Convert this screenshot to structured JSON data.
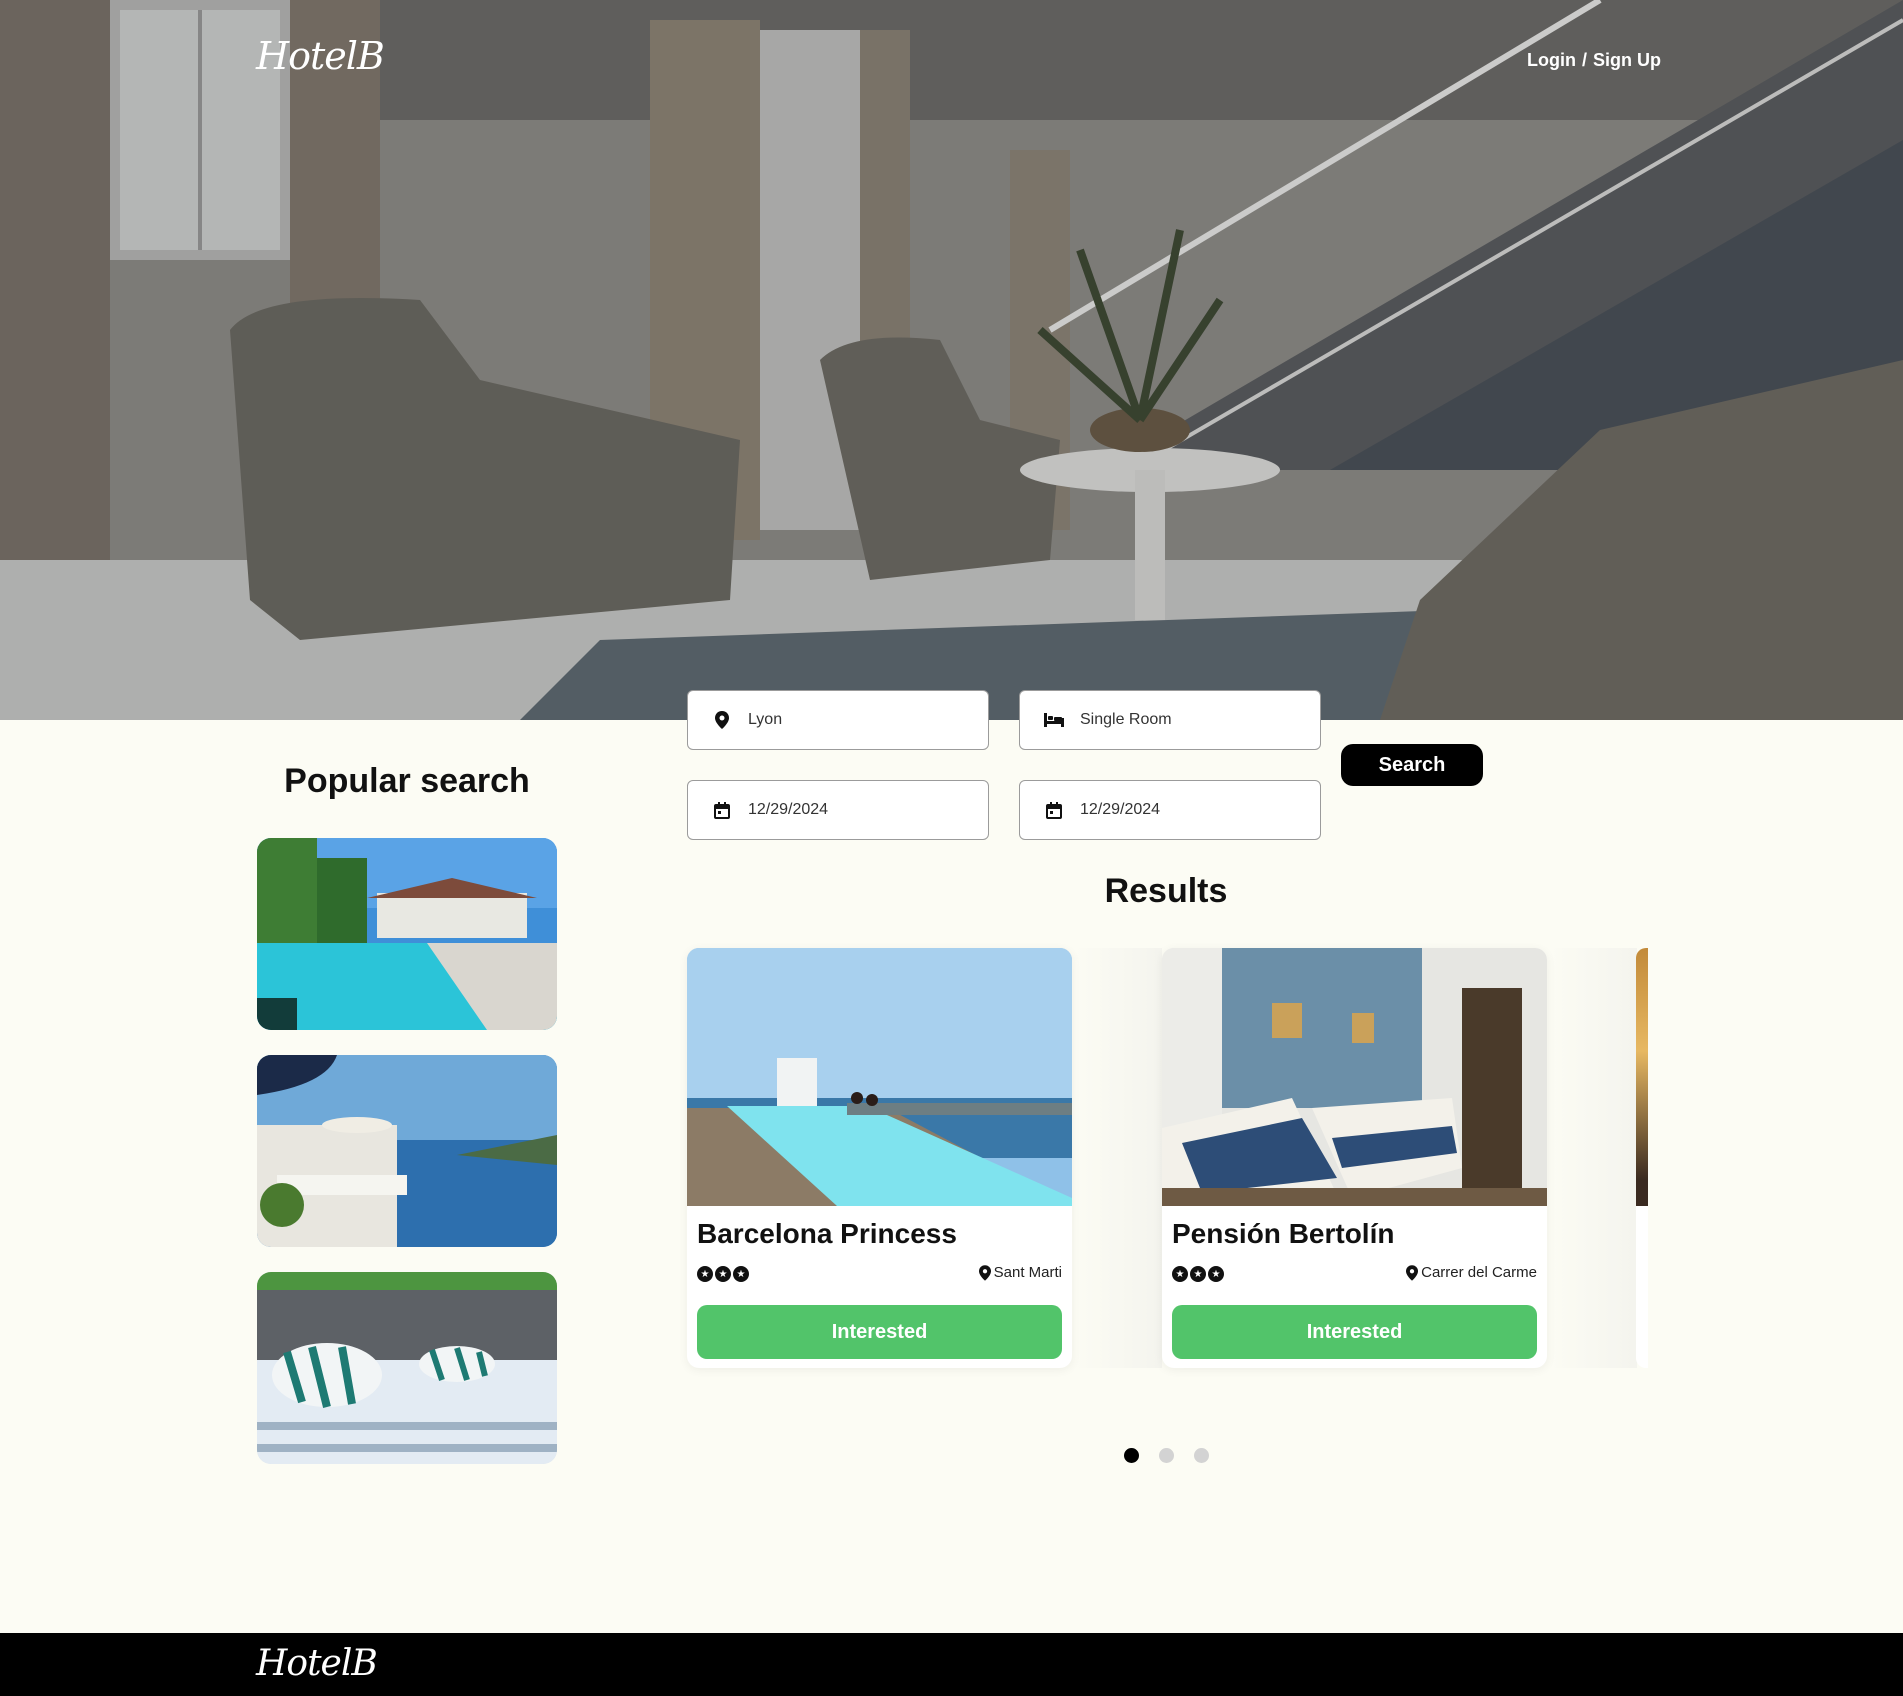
{
  "brand": {
    "logo_text": "HotelB"
  },
  "header": {
    "login_label": "Login",
    "separator": "/",
    "signup_label": "Sign Up"
  },
  "search": {
    "location": "Lyon",
    "room_type": "Single Room",
    "check_in": "12/29/2024",
    "check_out": "12/29/2024",
    "button_label": "Search"
  },
  "popular": {
    "title": "Popular search"
  },
  "results": {
    "title": "Results",
    "cards": [
      {
        "name": "Barcelona Princess",
        "location": "Sant Marti",
        "stars": 3,
        "button_label": "Interested"
      },
      {
        "name": "Pensión Bertolín",
        "location": "Carrer del Carme",
        "stars": 3,
        "button_label": "Interested"
      }
    ]
  },
  "carousel": {
    "pages": 3,
    "active": 1
  },
  "footer": {
    "logo_text": "HotelB"
  },
  "colors": {
    "accent": "#52c46a",
    "background": "#fcfcf4",
    "footer": "#000000"
  }
}
